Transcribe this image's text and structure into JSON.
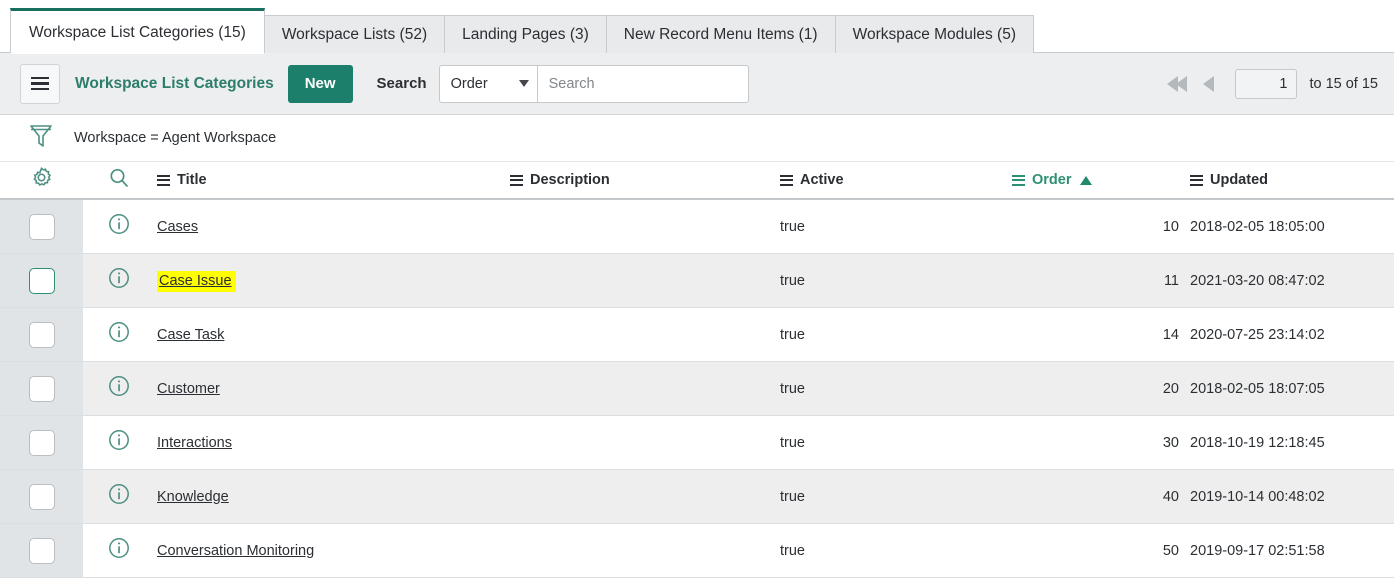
{
  "tabs": [
    {
      "label": "Workspace List Categories (15)",
      "active": true
    },
    {
      "label": "Workspace Lists (52)",
      "active": false
    },
    {
      "label": "Landing Pages (3)",
      "active": false
    },
    {
      "label": "New Record Menu Items (1)",
      "active": false
    },
    {
      "label": "Workspace Modules (5)",
      "active": false
    }
  ],
  "toolbar": {
    "menu_icon": "hamburger-icon",
    "list_title": "Workspace List Categories",
    "new_label": "New",
    "search_label": "Search",
    "search_field_value": "Order",
    "search_placeholder": "Search",
    "dropdown_icon": "chevron-down-icon"
  },
  "pagination": {
    "first_icon": "double-left-arrow-icon",
    "prev_icon": "left-arrow-icon",
    "page_value": "1",
    "range_text": "to 15 of 15"
  },
  "filter": {
    "icon": "funnel-icon",
    "text": "Workspace = Agent Workspace"
  },
  "columns": {
    "gear_icon": "gear-icon",
    "search_icon": "search-icon",
    "headers": [
      {
        "label": "Title",
        "sorted": false
      },
      {
        "label": "Description",
        "sorted": false
      },
      {
        "label": "Active",
        "sorted": false
      },
      {
        "label": "Order",
        "sorted": true,
        "direction": "asc"
      },
      {
        "label": "Updated",
        "sorted": false
      }
    ]
  },
  "rows": [
    {
      "title": "Cases",
      "description": "",
      "active": "true",
      "order": "10",
      "updated": "2018-02-05 18:05:00",
      "highlighted": false,
      "checkbox_focused": false
    },
    {
      "title": "Case Issue",
      "description": "",
      "active": "true",
      "order": "11",
      "updated": "2021-03-20 08:47:02",
      "highlighted": true,
      "checkbox_focused": true
    },
    {
      "title": "Case Task",
      "description": "",
      "active": "true",
      "order": "14",
      "updated": "2020-07-25 23:14:02",
      "highlighted": false,
      "checkbox_focused": false
    },
    {
      "title": "Customer",
      "description": "",
      "active": "true",
      "order": "20",
      "updated": "2018-02-05 18:07:05",
      "highlighted": false,
      "checkbox_focused": false
    },
    {
      "title": "Interactions",
      "description": "",
      "active": "true",
      "order": "30",
      "updated": "2018-10-19 12:18:45",
      "highlighted": false,
      "checkbox_focused": false
    },
    {
      "title": "Knowledge",
      "description": "",
      "active": "true",
      "order": "40",
      "updated": "2019-10-14 00:48:02",
      "highlighted": false,
      "checkbox_focused": false
    },
    {
      "title": "Conversation Monitoring",
      "description": "",
      "active": "true",
      "order": "50",
      "updated": "2019-09-17 02:51:58",
      "highlighted": false,
      "checkbox_focused": false
    }
  ],
  "colors": {
    "brand_teal": "#1c7f6c",
    "link_teal": "#2d7d6d",
    "sort_teal": "#2d8f73",
    "highlight_yellow": "#ffff00",
    "toolbar_bg": "#eceef0",
    "row_alt_bg": "#eeeeee",
    "check_col_bg": "#e1e4e6"
  }
}
